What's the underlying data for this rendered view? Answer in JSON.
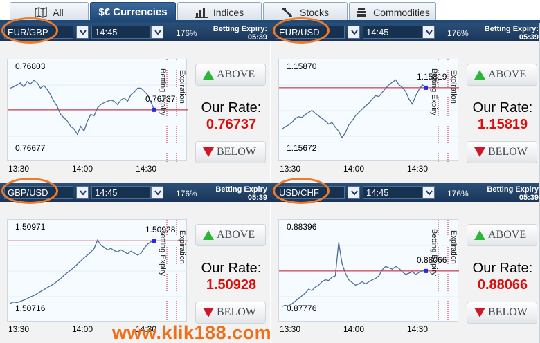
{
  "tabs": [
    {
      "label": "All",
      "icon": "map-icon",
      "active": false
    },
    {
      "label": "$€ Currencies",
      "icon": "",
      "active": true
    },
    {
      "label": "Indices",
      "icon": "bar-chart-icon",
      "active": false
    },
    {
      "label": "Stocks",
      "icon": "stocks-icon",
      "active": false
    },
    {
      "label": "Commodities",
      "icon": "commodities-icon",
      "active": false
    }
  ],
  "panels": [
    {
      "pair": "EUR/GBP",
      "expiry_time": "14:45",
      "payout": "176%",
      "expiry_label": "Betting Expiry:",
      "expiry_countdown": "05:39",
      "chart_high": "0.76803",
      "chart_low": "0.76677",
      "current_label": "0.76737",
      "x_ticks": [
        "13:30",
        "14:00",
        "14:30"
      ],
      "vertical_label_1": "Betting Expiry",
      "vertical_label_2": "Expiration",
      "above_label": "ABOVE",
      "below_label": "BELOW",
      "rate_label": "Our Rate:",
      "rate_value": "0.76737",
      "series": [
        0.7677,
        0.76772,
        0.76775,
        0.76778,
        0.76772,
        0.7678,
        0.76776,
        0.76782,
        0.76778,
        0.7677,
        0.76774,
        0.76768,
        0.7676,
        0.7675,
        0.76742,
        0.7673,
        0.76725,
        0.7672,
        0.76712,
        0.76708,
        0.767,
        0.76712,
        0.76705,
        0.7672,
        0.7673,
        0.76728,
        0.7674,
        0.76745,
        0.76748,
        0.7675,
        0.76752,
        0.7675,
        0.76745,
        0.76752,
        0.76755,
        0.7675,
        0.7676,
        0.76764,
        0.7677,
        0.7677,
        0.76765,
        0.7676,
        0.76748,
        0.76737
      ]
    },
    {
      "pair": "EUR/USD",
      "expiry_time": "14:45",
      "payout": "176%",
      "expiry_label": "Betting Expiry:",
      "expiry_countdown": "05:39",
      "chart_high": "1.15870",
      "chart_low": "1.15672",
      "current_label": "1.15819",
      "x_ticks": [
        "13:30",
        "14:00",
        "14:30"
      ],
      "vertical_label_1": "Betting Expiry",
      "vertical_label_2": "Expiration",
      "above_label": "ABOVE",
      "below_label": "BELOW",
      "rate_label": "Our Rate:",
      "rate_value": "1.15819",
      "series": [
        1.1572,
        1.15726,
        1.1573,
        1.15736,
        1.15745,
        1.1575,
        1.15748,
        1.15755,
        1.1576,
        1.15765,
        1.15758,
        1.15752,
        1.15746,
        1.1574,
        1.15732,
        1.15736,
        1.15725,
        1.15715,
        1.157,
        1.15712,
        1.1573,
        1.1574,
        1.15752,
        1.1576,
        1.15768,
        1.15775,
        1.15782,
        1.15792,
        1.158,
        1.15798,
        1.15808,
        1.15818,
        1.15826,
        1.15832,
        1.15838,
        1.15826,
        1.1582,
        1.1581,
        1.15792,
        1.1578,
        1.158,
        1.15815,
        1.15826,
        1.15819
      ]
    },
    {
      "pair": "GBP/USD",
      "expiry_time": "14:45",
      "payout": "176%",
      "expiry_label": "Betting Expiry",
      "expiry_countdown": "05:39",
      "chart_high": "1.50971",
      "chart_low": "1.50716",
      "current_label": "1.50928",
      "x_ticks": [
        "13:30",
        "14:00",
        "14:30"
      ],
      "vertical_label_1": "Betting Expiry",
      "vertical_label_2": "Expiration",
      "above_label": "ABOVE",
      "below_label": "BELOW",
      "rate_label": "Our Rate:",
      "rate_value": "1.50928",
      "series": [
        1.50736,
        1.5074,
        1.50738,
        1.50742,
        1.50746,
        1.5075,
        1.50756,
        1.5076,
        1.50766,
        1.50772,
        1.50778,
        1.50784,
        1.5079,
        1.50796,
        1.50804,
        1.50812,
        1.50822,
        1.5083,
        1.50838,
        1.50846,
        1.50856,
        1.50866,
        1.50876,
        1.50884,
        1.50893,
        1.50904,
        1.5093,
        1.50915,
        1.50908,
        1.509,
        1.50905,
        1.50898,
        1.50894,
        1.509,
        1.50894,
        1.50888,
        1.50896,
        1.5089,
        1.50884,
        1.5089,
        1.50906,
        1.50918,
        1.50925,
        1.50928
      ]
    },
    {
      "pair": "USD/CHF",
      "expiry_time": "14:45",
      "payout": "176%",
      "expiry_label": "Betting Expiry",
      "expiry_countdown": "05:39",
      "chart_high": "0.88396",
      "chart_low": "0.87776",
      "current_label": "0.88066",
      "x_ticks": [
        "13:30",
        "14:00",
        "14:30"
      ],
      "vertical_label_1": "Betting Expiry",
      "vertical_label_2": "Expiration",
      "above_label": "ABOVE",
      "below_label": "BELOW",
      "rate_label": "Our Rate:",
      "rate_value": "0.88066",
      "series": [
        0.878,
        0.8781,
        0.87805,
        0.8782,
        0.8784,
        0.8786,
        0.8788,
        0.879,
        0.8793,
        0.8792,
        0.87945,
        0.8796,
        0.87985,
        0.88,
        0.87995,
        0.8802,
        0.8803,
        0.8828,
        0.8812,
        0.8805,
        0.88,
        0.8798,
        0.8796,
        0.8797,
        0.87985,
        0.8797,
        0.87985,
        0.88,
        0.8801,
        0.8803,
        0.88075,
        0.881,
        0.8809,
        0.8808,
        0.881,
        0.88085,
        0.8806,
        0.8804,
        0.8805,
        0.8806,
        0.8804,
        0.88055,
        0.8807,
        0.88066
      ]
    }
  ],
  "watermark": "www.klik188.com",
  "colors": {
    "header_blue": "#1f4a78",
    "rate_red": "#e00b0b",
    "chart_line": "#4d6e95",
    "current_line": "#c0122b",
    "highlight_orange": "#f07a26",
    "above_green": "#2db53a",
    "below_red": "#d0172a"
  }
}
